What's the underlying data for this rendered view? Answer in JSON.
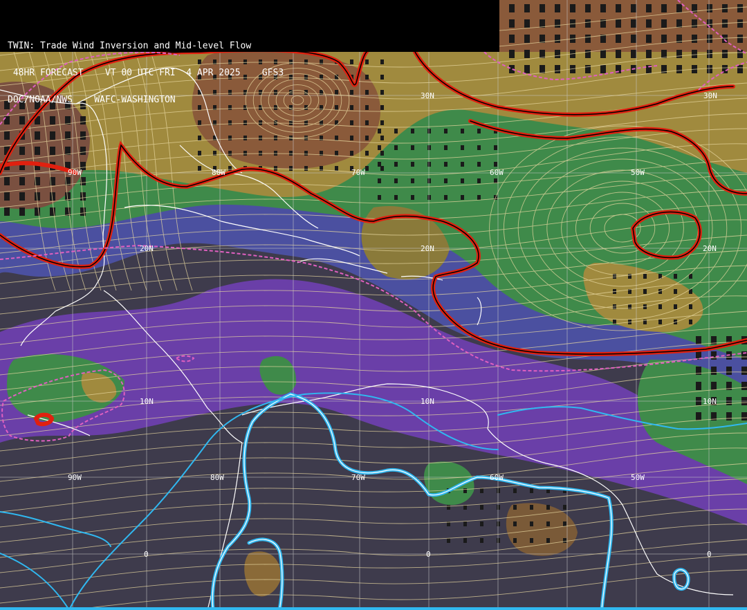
{
  "header": {
    "line1": "TWIN: Trade Wind Inversion and Mid-level Flow",
    "line2": " 48HR FORECAST    VT 00 UTC FRI  4 APR 2025    GFS3",
    "line3": "DOC/NOAA/NWS    WAFC-WASHINGTON"
  },
  "grid_labels": {
    "lat": [
      "30N",
      "30N",
      "20N",
      "20N",
      "20N",
      "10N",
      "10N",
      "10N",
      "0",
      "0",
      "0"
    ],
    "lon": [
      "90W",
      "80W",
      "70W",
      "60W",
      "50W",
      "90W",
      "80W",
      "70W",
      "60W",
      "50W"
    ]
  },
  "colors": {
    "background": "#3e3b4c",
    "purple_shade": "#7b45b8",
    "blue_shade": "#4b50a0",
    "green_shade": "#3f8a4a",
    "olive_shade": "#a08a3e",
    "brown_shade": "#8a5a3a",
    "red_contour": "#e0200f",
    "magenta_dashed": "#e060c0",
    "cyan_contour": "#30b8f0",
    "streamline": "#e8d8a0",
    "coastline": "#ffffff",
    "gridline": "#c8c8c8"
  }
}
